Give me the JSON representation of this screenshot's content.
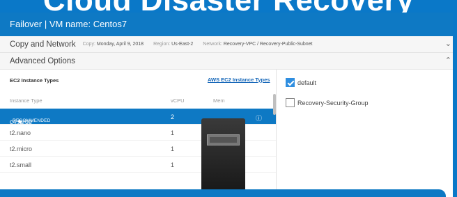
{
  "banner": {
    "title": "Cloud Disaster Recovery"
  },
  "window": {
    "title": "Failover | VM name: Centos7"
  },
  "copy_network": {
    "label": "Copy and Network",
    "copy_label": "Copy:",
    "copy_value": "Monday, April 9, 2018",
    "region_label": "Region:",
    "region_value": "Us-East-2",
    "network_label": "Network:",
    "network_value": "Recovery-VPC / Recovery-Public-Subnet",
    "chevron_icon": "chevron-down-icon"
  },
  "advanced": {
    "label": "Advanced Options",
    "chevron_icon": "chevron-up-icon"
  },
  "ec2": {
    "title": "EC2 Instance Types",
    "link": "AWS EC2 Instance Types",
    "columns": [
      "Instance Type",
      "vCPU",
      "Mem"
    ],
    "rows": [
      {
        "type": "c4.large",
        "vcpu": "2",
        "recommended": "RECOMMENDED",
        "selected": true
      },
      {
        "type": "t2.nano",
        "vcpu": "1"
      },
      {
        "type": "t2.micro",
        "vcpu": "1"
      },
      {
        "type": "t2.small",
        "vcpu": "1"
      }
    ]
  },
  "security_groups": [
    {
      "label": "default",
      "checked": true
    },
    {
      "label": "Recovery-Security-Group",
      "checked": false
    }
  ],
  "colors": {
    "accent": "#0e79c4",
    "checkbox": "#2f8ee0"
  }
}
